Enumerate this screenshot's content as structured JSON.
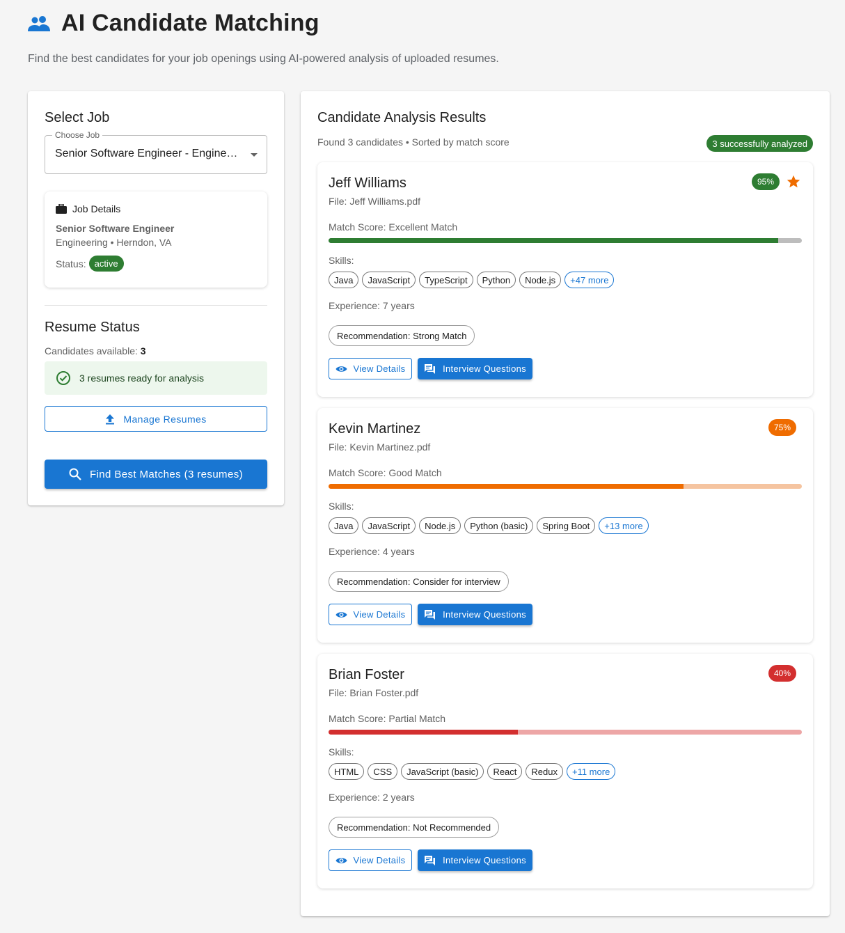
{
  "header": {
    "title": "AI Candidate Matching",
    "subtitle": "Find the best candidates for your job openings using AI-powered analysis of uploaded resumes."
  },
  "left": {
    "select_title": "Select Job",
    "choose_label": "Choose Job",
    "selected_job": "Senior Software Engineer - Engineering",
    "job_details": {
      "header": "Job Details",
      "title": "Senior Software Engineer",
      "meta": "Engineering • Herndon, VA",
      "status_label": "Status:",
      "status": "active"
    },
    "resume_title": "Resume Status",
    "candidates_label": "Candidates available:",
    "candidates_count": "3",
    "ready_text": "3 resumes ready for analysis",
    "manage_label": "Manage Resumes",
    "find_label": "Find Best Matches (3 resumes)"
  },
  "results": {
    "title": "Candidate Analysis Results",
    "found_text": "Found 3 candidates • Sorted by match score",
    "analyzed_badge": "3 successfully analyzed",
    "view_label": "View Details",
    "iq_label": "Interview Questions",
    "candidates": [
      {
        "name": "Jeff Williams",
        "file": "File: Jeff Williams.pdf",
        "score_text": "95%",
        "score": 95,
        "starred": true,
        "match_label": "Match Score: Excellent Match",
        "skills_label": "Skills:",
        "skills": [
          "Java",
          "JavaScript",
          "TypeScript",
          "Python",
          "Node.js"
        ],
        "more": "+47 more",
        "experience": "Experience: 7 years",
        "recommendation": "Recommendation: Strong Match",
        "color": "#2e7d32",
        "track_color": "#bdbdbd"
      },
      {
        "name": "Kevin Martinez",
        "file": "File: Kevin Martinez.pdf",
        "score_text": "75%",
        "score": 75,
        "starred": false,
        "match_label": "Match Score: Good Match",
        "skills_label": "Skills:",
        "skills": [
          "Java",
          "JavaScript",
          "Node.js",
          "Python (basic)",
          "Spring Boot"
        ],
        "more": "+13 more",
        "experience": "Experience: 4 years",
        "recommendation": "Recommendation: Consider for interview",
        "color": "#ef6c00",
        "track_color": "#f5c4a0"
      },
      {
        "name": "Brian Foster",
        "file": "File: Brian Foster.pdf",
        "score_text": "40%",
        "score": 40,
        "starred": false,
        "match_label": "Match Score: Partial Match",
        "skills_label": "Skills:",
        "skills": [
          "HTML",
          "CSS",
          "JavaScript (basic)",
          "React",
          "Redux"
        ],
        "more": "+11 more",
        "experience": "Experience: 2 years",
        "recommendation": "Recommendation: Not Recommended",
        "color": "#d32f2f",
        "track_color": "#eda6a6"
      }
    ]
  },
  "colors": {
    "primary": "#1976d2",
    "success": "#2e7d32",
    "star": "#ef6c00"
  },
  "icons": {
    "header": "people-icon",
    "job_details": "briefcase-icon",
    "ready": "check-circle-icon",
    "manage": "upload-icon",
    "find": "search-icon",
    "view": "eye-icon",
    "questions": "chat-icon",
    "top_match": "star-icon"
  }
}
